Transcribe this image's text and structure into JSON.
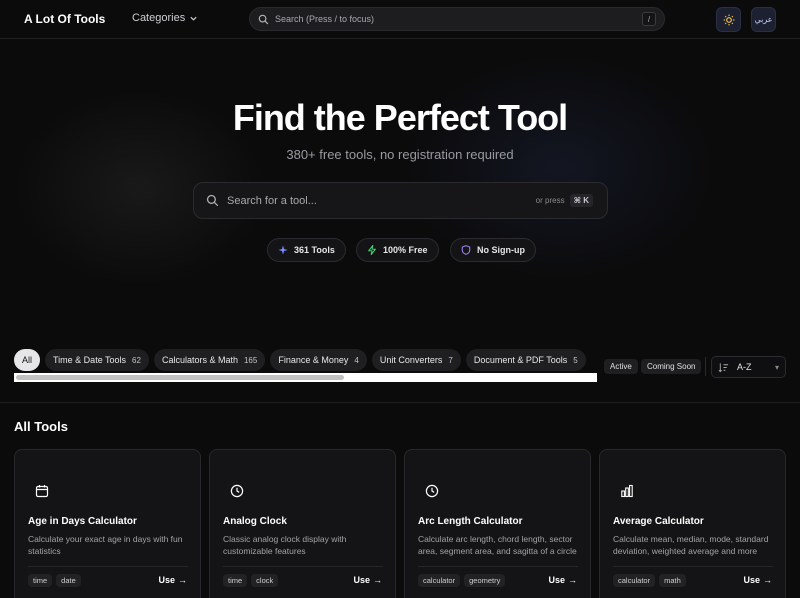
{
  "header": {
    "logo": "A Lot Of Tools",
    "categories_label": "Categories",
    "search_placeholder": "Search (Press / to focus)",
    "search_shortcut": "/",
    "language_label": "عربي"
  },
  "hero": {
    "title": "Find the Perfect Tool",
    "subtitle": "380+ free tools, no registration required",
    "search_placeholder": "Search for a tool...",
    "hint_prefix": "or press",
    "hint_key": "⌘ K",
    "stats": [
      {
        "label": "361 Tools",
        "icon": "sparkles-icon",
        "color": "#7c8cff"
      },
      {
        "label": "100% Free",
        "icon": "zap-icon",
        "color": "#4ade80"
      },
      {
        "label": "No Sign-up",
        "icon": "shield-icon",
        "color": "#a78bfa"
      }
    ]
  },
  "filters": {
    "categories": [
      {
        "label": "All",
        "count": null,
        "active": true
      },
      {
        "label": "Time & Date Tools",
        "count": "62"
      },
      {
        "label": "Calculators & Math",
        "count": "165"
      },
      {
        "label": "Finance & Money",
        "count": "4"
      },
      {
        "label": "Unit Converters",
        "count": "7"
      },
      {
        "label": "Document & PDF Tools",
        "count": "5"
      }
    ],
    "status": [
      "Active",
      "Coming Soon"
    ],
    "sort_value": "A-Z"
  },
  "section_title": "All Tools",
  "cards": [
    {
      "title": "Age in Days Calculator",
      "desc": "Calculate your exact age in days with fun statistics",
      "tags": [
        "time",
        "date"
      ],
      "icon": "calendar-icon",
      "use": "Use"
    },
    {
      "title": "Analog Clock",
      "desc": "Classic analog clock display with customizable features",
      "tags": [
        "time",
        "clock"
      ],
      "icon": "clock-icon",
      "use": "Use"
    },
    {
      "title": "Arc Length Calculator",
      "desc": "Calculate arc length, chord length, sector area, segment area, and sagitta of a circle",
      "tags": [
        "calculator",
        "geometry"
      ],
      "icon": "clock-icon",
      "use": "Use"
    },
    {
      "title": "Average Calculator",
      "desc": "Calculate mean, median, mode, standard deviation, weighted average and more",
      "tags": [
        "calculator",
        "math"
      ],
      "icon": "bar-chart-icon",
      "use": "Use"
    }
  ]
}
